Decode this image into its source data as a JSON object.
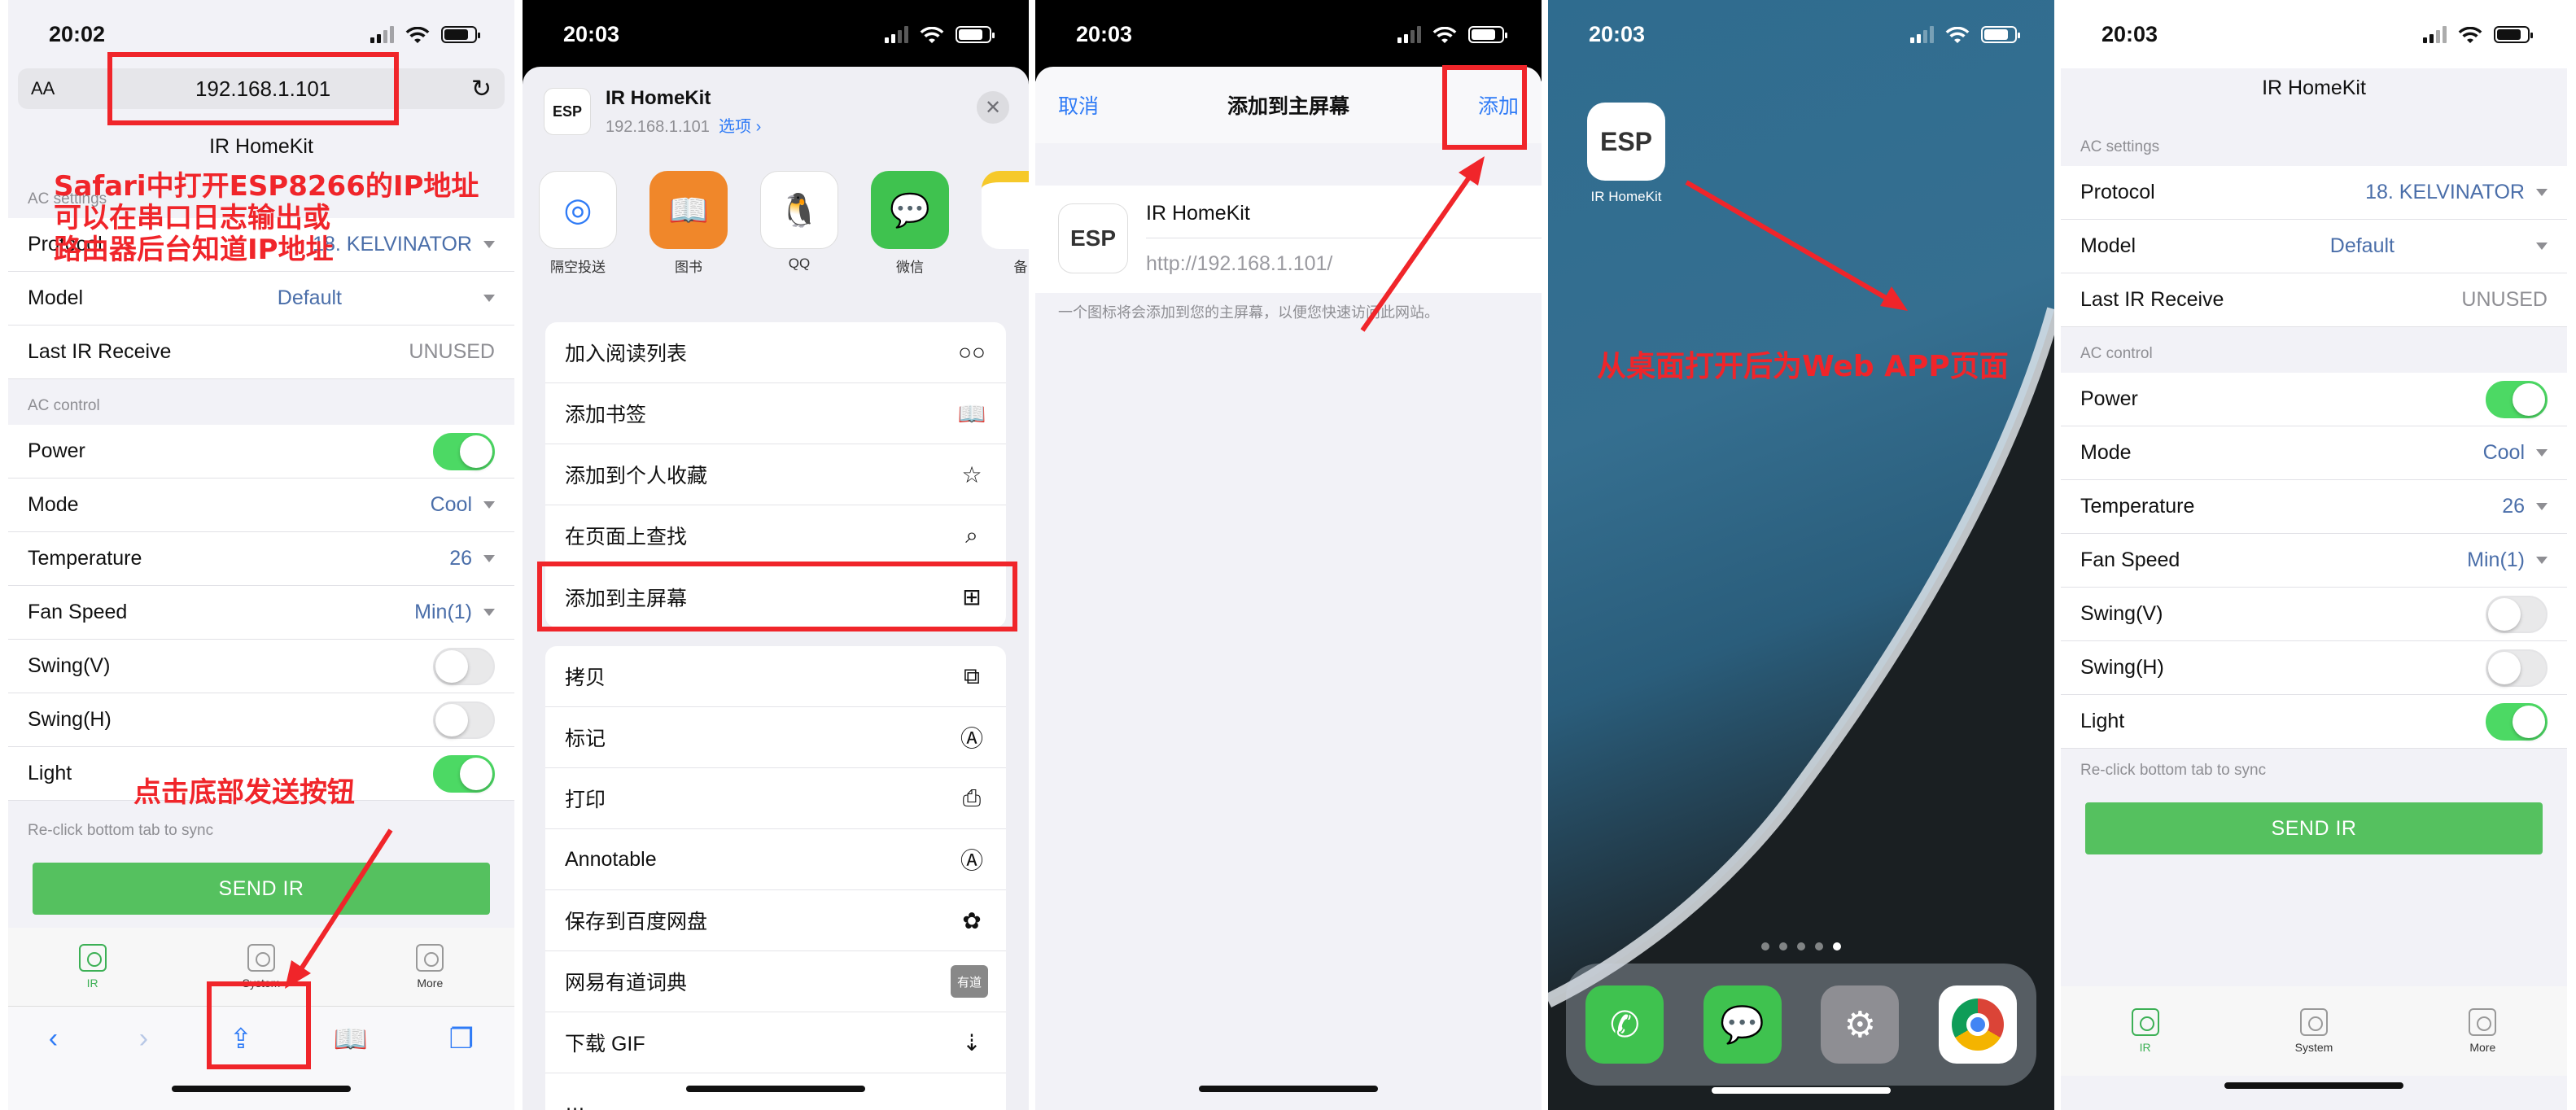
{
  "status": {
    "time1": "20:02",
    "time2": "20:03",
    "time3": "20:03",
    "time4": "20:03",
    "time5": "20:03"
  },
  "safari": {
    "aa": "AA",
    "url": "192.168.1.101"
  },
  "app": {
    "title": "IR HomeKit",
    "ac_settings_header": "AC settings",
    "protocol_label": "Protocol",
    "protocol_value": "18. KELVINATOR",
    "model_label": "Model",
    "model_value": "Default",
    "last_ir_label": "Last IR Receive",
    "last_ir_value": "UNUSED",
    "ac_control_header": "AC control",
    "power_label": "Power",
    "mode_label": "Mode",
    "mode_value": "Cool",
    "temp_label": "Temperature",
    "temp_value": "26",
    "fan_label": "Fan Speed",
    "fan_value": "Min(1)",
    "swingv_label": "Swing(V)",
    "swingh_label": "Swing(H)",
    "light_label": "Light",
    "hint": "Re-click bottom tab to sync",
    "send_label": "SEND IR",
    "tabs": [
      {
        "label": "IR"
      },
      {
        "label": "System"
      },
      {
        "label": "More"
      }
    ]
  },
  "annotations": {
    "a1_l1": "Safari中打开ESP8266的IP地址",
    "a1_l2": "可以在串口日志输出或",
    "a1_l3": "路由器后台知道IP地址",
    "a2": "点击底部发送按钮",
    "a3": "从桌面打开后为Web APP页面"
  },
  "share": {
    "icon": "ESP",
    "title": "IR HomeKit",
    "host": "192.168.1.101",
    "options": "选项 ›",
    "apps": [
      {
        "label": "隔空投送",
        "icon": "airdrop-icon",
        "color": "#ffffff"
      },
      {
        "label": "图书",
        "icon": "books-icon",
        "color": "#f0872a"
      },
      {
        "label": "QQ",
        "icon": "qq-icon",
        "color": "#ffffff"
      },
      {
        "label": "微信",
        "icon": "wechat-icon",
        "color": "#3fc24f"
      },
      {
        "label": "备",
        "icon": "notes-icon",
        "color": "#ffffff"
      }
    ],
    "menu_a": [
      {
        "label": "加入阅读列表",
        "glyph": "○○"
      },
      {
        "label": "添加书签",
        "glyph": "📖"
      },
      {
        "label": "添加到个人收藏",
        "glyph": "☆"
      },
      {
        "label": "在页面上查找",
        "glyph": "⌕"
      },
      {
        "label": "添加到主屏幕",
        "glyph": "⊞"
      }
    ],
    "menu_b": [
      {
        "label": "拷贝",
        "glyph": "⧉"
      },
      {
        "label": "标记",
        "glyph": "Ⓐ"
      },
      {
        "label": "打印",
        "glyph": "⎙"
      },
      {
        "label": "Annotable",
        "glyph": "Ⓐ"
      },
      {
        "label": "保存到百度网盘",
        "glyph": "✿"
      },
      {
        "label": "网易有道词典",
        "glyph": "有道"
      },
      {
        "label": "下载 GIF",
        "glyph": "⇣"
      },
      {
        "label": "…",
        "glyph": ""
      }
    ]
  },
  "addhome": {
    "cancel": "取消",
    "title": "添加到主屏幕",
    "add": "添加",
    "icon": "ESP",
    "name": "IR HomeKit",
    "url": "http://192.168.1.101/",
    "note": "一个图标将会添加到您的主屏幕，以便您快速访问此网站。"
  },
  "homescreen": {
    "icon": "ESP",
    "label": "IR HomeKit"
  }
}
